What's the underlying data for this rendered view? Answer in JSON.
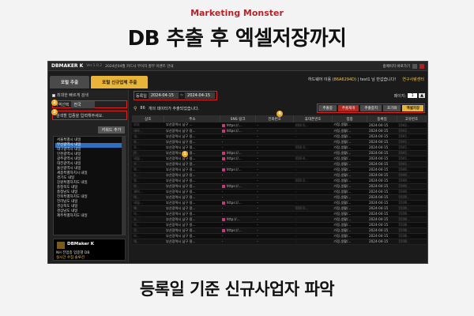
{
  "header": {
    "brand": "Marketing Monster",
    "title": "DB 추출 후 엑셀저장까지",
    "subtitle": "등록일 기준 신규사업자 파악"
  },
  "app": {
    "titlebar": {
      "logo": "DBMAKER K",
      "version": "Ver.1.0.2",
      "notice": "2024년04월 카드사 무이자 할부 이벤트 안내",
      "home": "홈페이지 바로가기"
    },
    "tabs": [
      {
        "label": "포털 추출",
        "active": false
      },
      {
        "label": "포털 신규업체 추출",
        "active": true
      }
    ],
    "info": {
      "text": "하드웨어 이용 (",
      "user": "86A6294D",
      "mid": ") | test1 님 반갑습니다!",
      "lab": "연구사랑센터"
    },
    "left": {
      "check_label": "최대한 빠르게 검색",
      "region_label": "지역선택",
      "region_value": "전국",
      "search_placeholder": "검색할 업종을 입력해주세요.",
      "keyword_button": "키워드 추가",
      "regions": [
        "서울특별시 내일",
        "부산광역시 내일",
        "대구광역시 내일",
        "인천광역시 내일",
        "광주광역시 내일",
        "대전광역시 내일",
        "울산광역시 내일",
        "세종특별자치시 내일",
        "경기도 내일",
        "강원특별자치도 내일",
        "충청북도 내일",
        "충청남도 내일",
        "전북특별자치도 내일",
        "전라남도 내일",
        "경상북도 내일",
        "경상남도 내일",
        "제주특별자치도 내일"
      ],
      "selected_index": 1,
      "promo_logo": "DBMaker K",
      "promo_line1": "NH 전업종 업종별 DB",
      "promo_line2": "실시간 수집 솔루션"
    },
    "right": {
      "date_label": "등록일",
      "date_from": "2024-04-15",
      "date_to": "2024-04-15",
      "date_sep": "~",
      "page_label": "페이지:",
      "page_value": "1",
      "result_text": "개의 데이터가 추출되었습니다.",
      "result_count": "86",
      "actions": [
        "추출중",
        "추출재개",
        "추출중지",
        "초기화",
        "엑셀저장"
      ],
      "columns": [
        "상호",
        "주소",
        "SNS 링크",
        "전화번호",
        "휴대폰번호",
        "업종",
        "등록일",
        "고유번호"
      ],
      "rows": [
        [
          "모모",
          "부산광역시 남구 ...",
          "https://...",
          "-",
          "010-5...",
          "가정,생활/...",
          "2024-04-15",
          "1542..."
        ],
        [
          "대아...",
          "부산광역시 남구 용...",
          "https://...",
          "-",
          "-",
          "가정,생활/...",
          "2024-04-15",
          "1542..."
        ],
        [
          "내...",
          "부산광역시 남구 용...",
          "-",
          "-",
          "-",
          "가정,생활/...",
          "2024-04-15",
          "1541..."
        ],
        [
          "포...",
          "부산광역시 남구 용...",
          "-",
          "-",
          "-",
          "가정,생활/...",
          "2024-04-15",
          "1541..."
        ],
        [
          "모...",
          "부산광역시 남구 용...",
          "-",
          "-",
          "010-3...",
          "가정,생활/...",
          "2024-04-15",
          "1541..."
        ],
        [
          "JY...",
          "부산광역시 남구 용...",
          "https://...",
          "-",
          "-",
          "가정,생활/...",
          "2024-04-15",
          "1541..."
        ],
        [
          "내일...",
          "부산광역시 남구 용...",
          "https://...",
          "-",
          "010-4...",
          "가정,생활/...",
          "2024-04-15",
          "1541..."
        ],
        [
          "우...",
          "부산광역시 남구 용...",
          "-",
          "-",
          "-",
          "가정,생활/...",
          "2024-04-15",
          "1541..."
        ],
        [
          "하...",
          "부산광역시 남구 용...",
          "https://...",
          "-",
          "-",
          "가정,생활/...",
          "2024-04-15",
          "1540..."
        ],
        [
          "도...",
          "부산광역시 남구 용...",
          "-",
          "-",
          "-",
          "가정,생활/...",
          "2024-04-15",
          "1540..."
        ],
        [
          "첫...",
          "부산광역시 남구 용...",
          "-",
          "-",
          "010-2...",
          "가정,생활/...",
          "2024-04-15",
          "1540..."
        ],
        [
          "빈...",
          "부산광역시 남구 용...",
          "https://...",
          "-",
          "-",
          "가정,생활/...",
          "2024-04-15",
          "1540..."
        ],
        [
          "센터...",
          "부산광역시 남구 용...",
          "-",
          "-",
          "-",
          "가정,생활/...",
          "2024-04-15",
          "1540..."
        ],
        [
          "대...",
          "부산광역시 남구 용...",
          "-",
          "-",
          "-",
          "가정,생활/...",
          "2024-04-15",
          "1539..."
        ],
        [
          "내일...",
          "부산광역시 남구 용...",
          "https://...",
          "-",
          "-",
          "가정,생활/...",
          "2024-04-15",
          "1539..."
        ],
        [
          "해...",
          "부산광역시 남구 용...",
          "-",
          "-",
          "010-5...",
          "가정,생활/...",
          "2024-04-15",
          "1539..."
        ],
        [
          "다...",
          "부산광역시 남구 용...",
          "-",
          "-",
          "-",
          "가정,생활/...",
          "2024-04-15",
          "1539..."
        ],
        [
          "소...",
          "부산광역시 남구 용...",
          "http://...",
          "-",
          "-",
          "가정,생활/...",
          "2024-04-15",
          "1539..."
        ],
        [
          "이...",
          "부산광역시 남구 용...",
          "-",
          "-",
          "-",
          "가정,생활/...",
          "2024-04-15",
          "1538..."
        ],
        [
          "진...",
          "부산광역시 남구 용...",
          "https://...",
          "-",
          "-",
          "가정,생활/...",
          "2024-04-15",
          "1538..."
        ],
        [
          "다...",
          "부산광역시 남구 용...",
          "-",
          "-",
          "-",
          "가정,생활/...",
          "2024-04-15",
          "1538..."
        ],
        [
          "대...",
          "부산광역시 남구 용...",
          "-",
          "-",
          "-",
          "가정,생활/...",
          "2024-04-15",
          "1538..."
        ]
      ]
    },
    "badges": [
      "1",
      "2",
      "3",
      "4"
    ]
  },
  "colors": {
    "accent": "#e8b53a",
    "highlight": "#dd2222",
    "brand": "#b4232a"
  }
}
